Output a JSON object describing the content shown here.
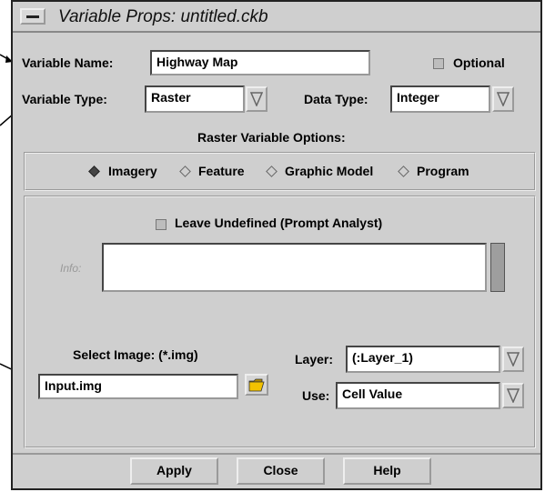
{
  "window": {
    "title": "Variable Props: untitled.ckb"
  },
  "variable_name": {
    "label": "Variable Name:",
    "value": "Highway Map"
  },
  "optional": {
    "label": "Optional",
    "checked": false
  },
  "variable_type": {
    "label": "Variable Type:",
    "value": "Raster"
  },
  "data_type": {
    "label": "Data Type:",
    "value": "Integer"
  },
  "raster_options": {
    "heading": "Raster Variable Options:",
    "options": [
      {
        "label": "Imagery",
        "selected": true
      },
      {
        "label": "Feature",
        "selected": false
      },
      {
        "label": "Graphic Model",
        "selected": false
      },
      {
        "label": "Program",
        "selected": false
      }
    ]
  },
  "leave_undefined": {
    "label": "Leave Undefined (Prompt Analyst)",
    "checked": false
  },
  "info": {
    "label": "Info:",
    "value": ""
  },
  "select_image": {
    "label": "Select Image: (*.img)",
    "value": "Input.img"
  },
  "layer": {
    "label": "Layer:",
    "value": "(:Layer_1)"
  },
  "use": {
    "label": "Use:",
    "value": "Cell Value"
  },
  "buttons": {
    "apply": "Apply",
    "close": "Close",
    "help": "Help"
  },
  "icons": {
    "menu": "window-menu-icon",
    "dropdown": "dropdown-arrow-icon",
    "folder": "open-folder-icon"
  }
}
